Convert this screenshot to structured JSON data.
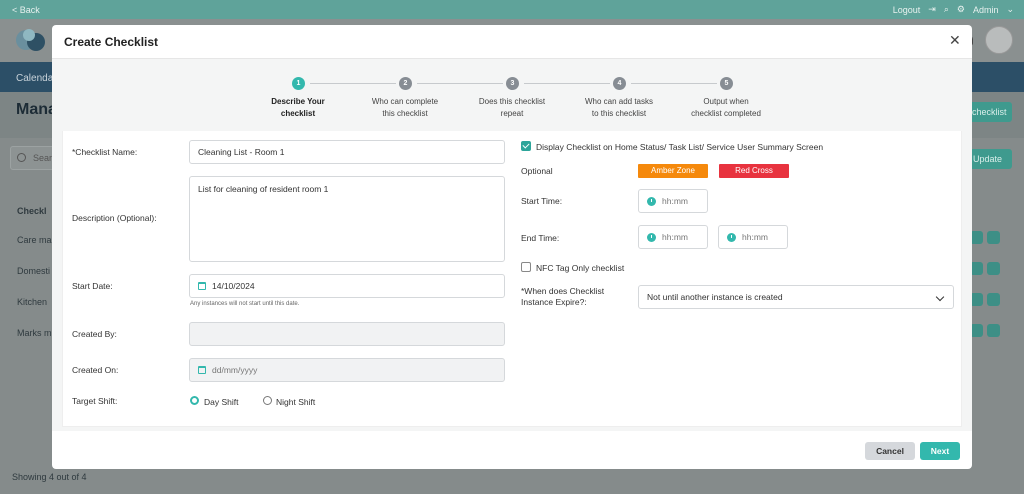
{
  "background": {
    "back_label": "< Back",
    "logout_label": "Logout",
    "admin_label": "Admin",
    "nav_first": "Calenda",
    "page_title": "Mana",
    "add_button_label": "checklist",
    "search_placeholder": "Sear",
    "update_button_label": "Update",
    "column_header": "Checkl",
    "rows": [
      "Care ma",
      "Domesti",
      "Kitchen",
      "Marks m"
    ],
    "footer_text": "Showing 4 out of 4"
  },
  "modal": {
    "title": "Create Checklist",
    "close_glyph": "✕",
    "steps": [
      {
        "number": "1",
        "label_line1": "Describe Your",
        "label_line2": "checklist"
      },
      {
        "number": "2",
        "label_line1": "Who can complete",
        "label_line2": "this checklist"
      },
      {
        "number": "3",
        "label_line1": "Does this checklist",
        "label_line2": "repeat"
      },
      {
        "number": "4",
        "label_line1": "Who can add tasks",
        "label_line2": "to this checklist"
      },
      {
        "number": "5",
        "label_line1": "Output when",
        "label_line2": "checklist completed"
      }
    ],
    "left": {
      "name_label": "*Checklist Name:",
      "name_value": "Cleaning List - Room 1",
      "description_label": "Description (Optional):",
      "description_value": "List for cleaning of resident room 1",
      "start_date_label": "Start Date:",
      "start_date_value": "14/10/2024",
      "start_date_hint": "Any instances will not start until this date.",
      "created_by_label": "Created By:",
      "created_by_value": "",
      "created_on_label": "Created On:",
      "created_on_placeholder": "dd/mm/yyyy",
      "target_shift_label": "Target Shift:",
      "day_shift_label": "Day Shift",
      "night_shift_label": "Night Shift"
    },
    "right": {
      "display_checkbox_label": "Display Checklist on Home Status/ Task List/ Service User Summary Screen",
      "optional_label": "Optional",
      "amber_zone_label": "Amber Zone",
      "red_cross_label": "Red Cross",
      "start_time_label": "Start Time:",
      "start_time_placeholder": "hh:mm",
      "end_time_label": "End Time:",
      "end_time_placeholder_1": "hh:mm",
      "end_time_placeholder_2": "hh:mm",
      "nfc_label": "NFC Tag Only checklist",
      "expire_label_line1": "*When does Checklist",
      "expire_label_line2": "Instance Expire?:",
      "expire_value": "Not until another instance is created"
    },
    "footer": {
      "cancel_label": "Cancel",
      "next_label": "Next"
    }
  },
  "colors": {
    "accent": "#33b8ad",
    "amber": "#f5890c",
    "red": "#e8333f",
    "nav": "#2c4f67"
  }
}
